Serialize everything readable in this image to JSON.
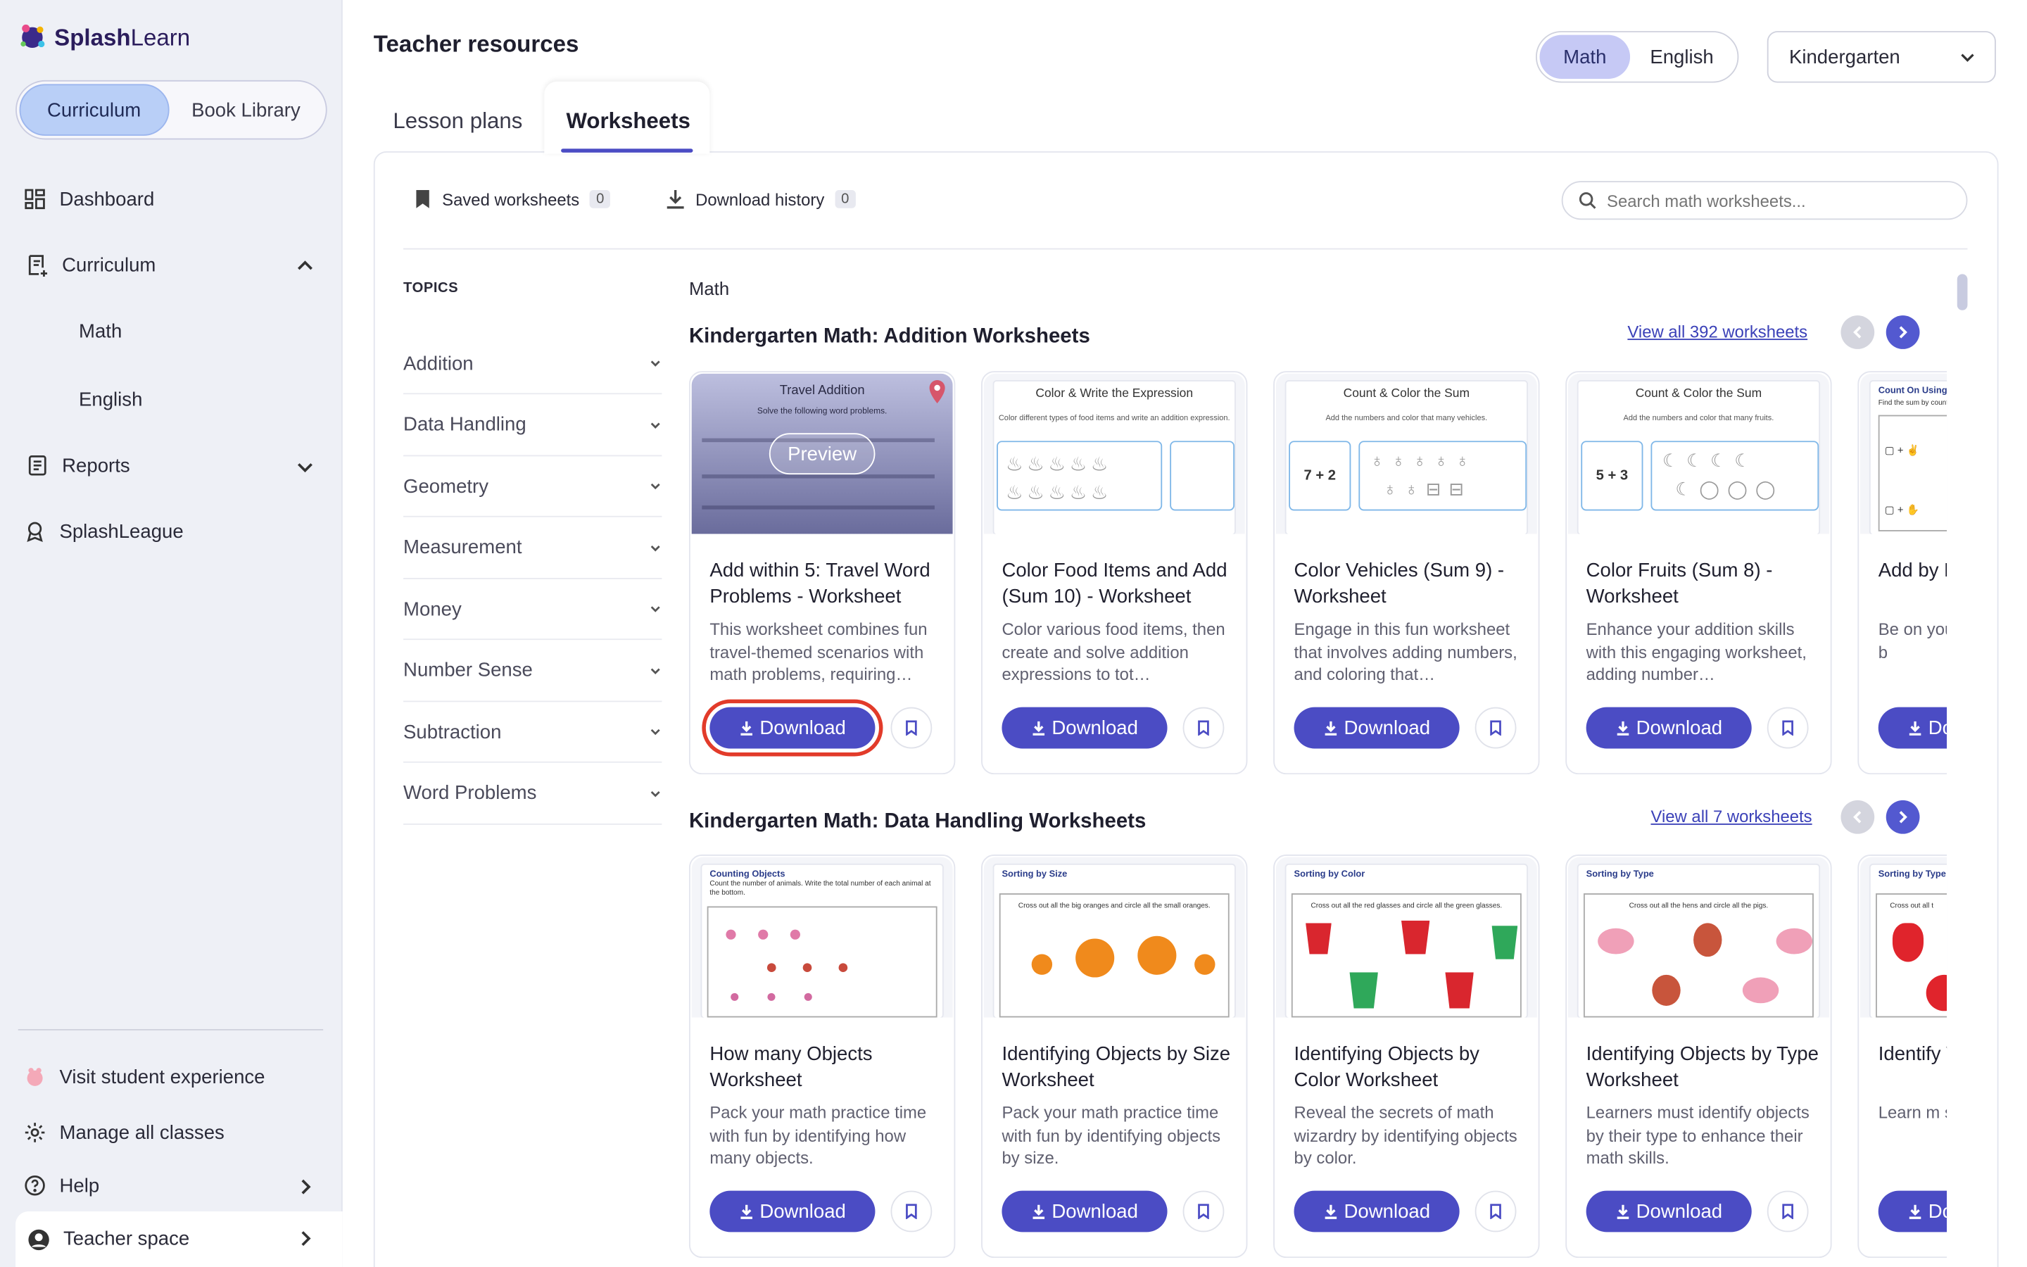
{
  "app": {
    "brand_bold": "Splash",
    "brand_light": "Learn"
  },
  "sidebar": {
    "toggle": {
      "curriculum": "Curriculum",
      "book_library": "Book Library"
    },
    "items": [
      {
        "label": "Dashboard",
        "icon": "dashboard-icon"
      },
      {
        "label": "Curriculum",
        "icon": "curriculum-icon"
      },
      {
        "label": "Reports",
        "icon": "reports-icon"
      },
      {
        "label": "SplashLeague",
        "icon": "league-icon"
      }
    ],
    "curriculum_sub": [
      "Math",
      "English"
    ],
    "bottom": {
      "visit": "Visit student experience",
      "manage": "Manage all classes",
      "help": "Help",
      "teacher_space": "Teacher space"
    }
  },
  "header": {
    "title": "Teacher resources",
    "subjects": [
      "Math",
      "English"
    ],
    "grade": "Kindergarten"
  },
  "tabs": [
    "Lesson plans",
    "Worksheets"
  ],
  "toolbar": {
    "saved": "Saved worksheets",
    "saved_count": "0",
    "history": "Download history",
    "history_count": "0",
    "search_placeholder": "Search math worksheets..."
  },
  "topics": {
    "heading": "TOPICS",
    "items": [
      "Addition",
      "Data Handling",
      "Geometry",
      "Measurement",
      "Money",
      "Number Sense",
      "Subtraction",
      "Word Problems"
    ]
  },
  "breadcrumb": "Math",
  "sections": [
    {
      "title": "Kindergarten Math: Addition Worksheets",
      "view_all": "View all 392 worksheets",
      "cards": [
        {
          "title": "Add within 5: Travel Word Problems - Worksheet",
          "desc": "This worksheet combines fun travel-themed scenarios with math problems, requiring…",
          "thumb_title": "Travel Addition",
          "thumb_instr": "Solve the following word problems.",
          "preview": "Preview"
        },
        {
          "title": "Color Food Items and Add (Sum 10) - Worksheet",
          "desc": "Color various food items, then create and solve addition expressions to tot…",
          "thumb_title": "Color & Write the Expression",
          "thumb_instr": "Color different types of food items and write an addition expression."
        },
        {
          "title": "Color Vehicles (Sum 9) - Worksheet",
          "desc": "Engage in this fun worksheet that involves adding numbers, and coloring that…",
          "thumb_title": "Count & Color the Sum",
          "thumb_instr": "Add the numbers and color that many vehicles.",
          "expr": "7 + 2"
        },
        {
          "title": "Color Fruits (Sum 8) - Worksheet",
          "desc": "Enhance your addition skills with this engaging worksheet, adding number…",
          "thumb_title": "Count & Color the Sum",
          "thumb_instr": "Add the numbers and color that many fruits.",
          "expr": "5 + 3"
        },
        {
          "title": "Add by Fingers",
          "desc": "Be on your mathematics to add b",
          "thumb_title": "Count On Using F",
          "thumb_instr": "Find the sum by count"
        }
      ]
    },
    {
      "title": "Kindergarten Math: Data Handling Worksheets",
      "view_all": "View all 7 worksheets",
      "cards": [
        {
          "title": "How many Objects Worksheet",
          "desc": "Pack your math practice time with fun by identifying how many objects.",
          "thumb_title": "Counting Objects",
          "thumb_instr": "Count the number of animals. Write the total number of each animal at the bottom."
        },
        {
          "title": "Identifying Objects by Size Worksheet",
          "desc": "Pack your math practice time with fun by identifying objects by size.",
          "thumb_title": "Sorting by Size",
          "thumb_instr": "Cross out all the big oranges and circle all the small oranges."
        },
        {
          "title": "Identifying Objects by Color Worksheet",
          "desc": "Reveal the secrets of math wizardry by identifying objects by color.",
          "thumb_title": "Sorting by Color",
          "thumb_instr": "Cross out all the red glasses and circle all the green glasses."
        },
        {
          "title": "Identifying Objects by Type Worksheet",
          "desc": "Learners must identify objects by their type to enhance their math skills.",
          "thumb_title": "Sorting by Type",
          "thumb_instr": "Cross out all the hens and circle all the pigs."
        },
        {
          "title": "Identify Worksh",
          "desc": "Learn m speed of practicir",
          "thumb_title": "Sorting by Type",
          "thumb_instr": "Cross out all t"
        }
      ]
    }
  ],
  "download_label": "Download",
  "colors": {
    "primary": "#4b4cc4",
    "highlight": "#e23b2a",
    "sidebar_bg": "#eef0f6"
  }
}
